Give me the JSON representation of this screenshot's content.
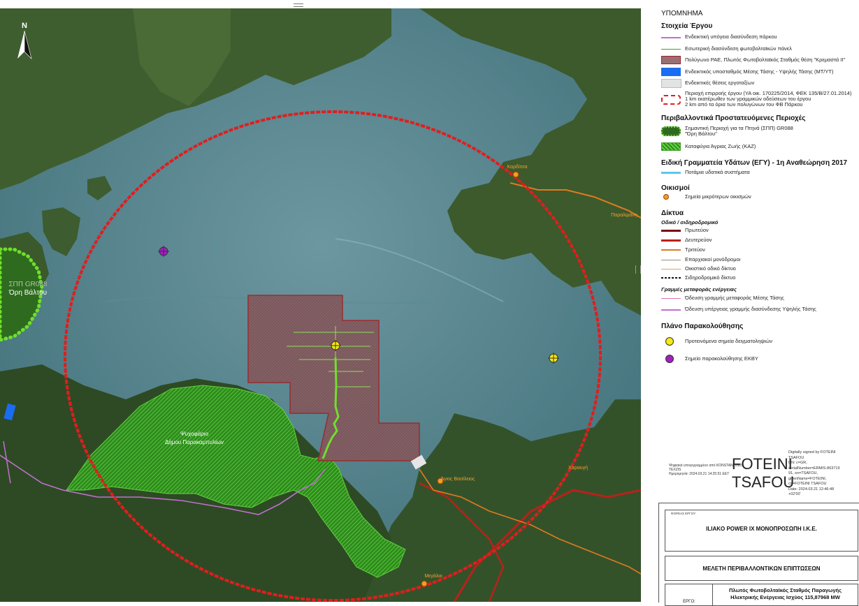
{
  "map": {
    "north_label": "N",
    "labels": {
      "spa_line1": "ΣΠΠ GR088",
      "spa_line2": "Όρη Βάλτου",
      "refuge_line1": "Ψυχοφάριο",
      "refuge_line2": "Δήμου Παρακαμπυλίων",
      "village_top": "Καρδίτσα",
      "village_right": "Παραλιμάνη",
      "village_center": "Άγιος Βασίλειος",
      "village_bottom_right": "Χαραυγή",
      "village_bottom": "Μεγάλοι"
    }
  },
  "legend": {
    "title": "ΥΠΟΜΝΗΜΑ",
    "project": {
      "heading": "Στοιχεία Έργου",
      "items": [
        "Ενδεικτική υπόγεια διασύνδεση πάρκου",
        "Εσωτερική διασύνδεση φωτοβολταϊκών πάνελ",
        "Πολύγωνο ΡΑΕ, Πλωτός Φωτοβολταϊκός Σταθμός θέση \"Κρεμαστά ΙΙ\"",
        "Ενδεικτικός υποσταθμός Μέσης Τάσης - Υψηλής Τάσης (ΜΤ/ΥΤ)",
        "Ενδεικτικές θέσεις εργοταξίων"
      ],
      "area_line1": "Περιοχή επιρροής έργου (ΥΑ οικ. 170225/2014, ΦΕΚ 135/Β/27.01.2014)",
      "area_line2": "1 km εκατέρωθεν των γραμμικών οδεύσεων του έργου",
      "area_line3": "2 km από τα όρια των πολυγώνων του ΦΒ Πάρκου"
    },
    "protected": {
      "heading": "Περιβαλλοντικά Προστατευόμενες Περιοχές",
      "spa_line1": "Σημαντική Περιοχή για τα Πτηνά (ΣΠΠ) GR088",
      "spa_line2": "\"Όρη Βάλτου\"",
      "refuge": "Καταφύγια Άγριας Ζωής (ΚΑΖ)"
    },
    "water": {
      "heading": "Ειδική Γραμματεία Υδάτων (ΕΓΥ) - 1η Αναθεώρηση 2017",
      "rivers": "Ποτάμια υδατικά συστήματα"
    },
    "settlements": {
      "heading": "Οικισμοί",
      "points": "Σημεία μικρότερων οικισμών"
    },
    "networks": {
      "heading": "Δίκτυα",
      "subheading": "Οδικό / σιδηροδρομικό",
      "roads": [
        "Πρωτεύον",
        "Δευτερεύον",
        "Τριτεύον",
        "Επαρχιακοί μονόδρομοι",
        "Οικιστικό οδικό δίκτυο",
        "Σιδηροδρομικό δίκτυο"
      ],
      "energy_heading": "Γραμμές μεταφοράς ενέργειας",
      "energy": [
        "Όδευση γραμμής μεταφοράς Μέσης Τάσης",
        "Όδευση υπέργειας γραμμής διασύνδεσης Υψηλής Τάσης"
      ]
    },
    "monitoring": {
      "heading": "Πλάνο Παρακολούθησης",
      "items": [
        "Προτεινόμενα σημεία δειγματοληψιών",
        "Σημείο παρακολούθησης ΕΚΒΥ"
      ]
    }
  },
  "signature": {
    "name_line1": "FOTEINI",
    "name_line2": "TSAFOU",
    "digital_small_1": "Ψηφιακά υπογεγραμμένο από KONSTANTINOS",
    "digital_small_2": "TEXZIS",
    "digital_small_3": "Ημερομηνία: 2024.03.21 14:25:51 EET",
    "digital_right": [
      "Digitally signed by FOTEINI",
      "TSAFOU",
      "DN: c=GR,",
      "serialNumber=ERMIS-863719",
      "91, sn=TSAFOU,",
      "givenName=FOTEINI,",
      "cn=FOTEINI TSAFOU",
      "Date: 2024.03.21 12:46:48",
      "+02'00'"
    ]
  },
  "titleblock": {
    "owner_label": "ΦΟΡΕΑΣ ΕΡΓΟΥ:",
    "owner": "ILIAKO POWER IX ΜΟΝΟΠΡΟΣΩΠΗ Ι.Κ.Ε.",
    "study": "ΜΕΛΕΤΗ ΠΕΡΙΒΑΛΛΟΝΤΙΚΩΝ ΕΠΙΠΤΩΣΕΩΝ",
    "project_label": "ΕΡΓΟ:",
    "project_line1": "Πλωτός Φωτοβολταϊκός Σταθμός Παραγωγής",
    "project_line2": "Ηλεκτρικής Ενέργειας Ισχύος 115,87968 MW"
  },
  "colors": {
    "water": "#4e7f8a",
    "land": "#3d5a2c",
    "influence_circle": "#e01e1e",
    "polygon_fill": "#8a5a5e",
    "refuge": "#3fa02a",
    "road_secondary": "#b8221a",
    "road_tertiary": "#e07a20",
    "hv_line": "#c070d0",
    "sample_point": "#f5ea12",
    "ekby_point": "#a020c0"
  }
}
